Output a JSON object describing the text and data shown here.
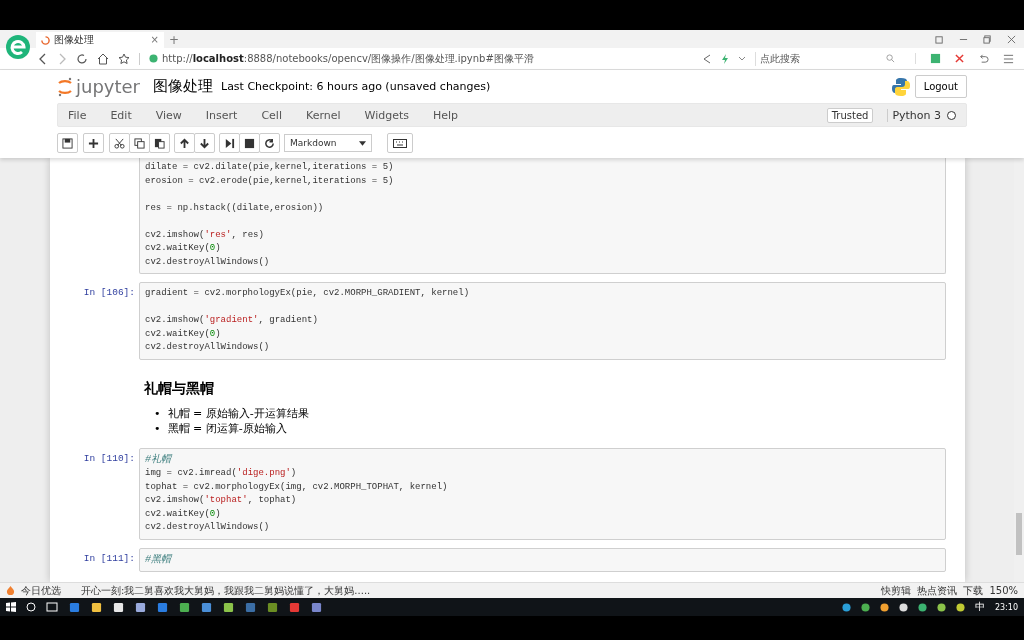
{
  "browser": {
    "tab_title": "图像处理",
    "tab_close": "×",
    "new_tab": "+",
    "url_prefix": "http://",
    "url_host": "localhost",
    "url_rest": ":8888/notebooks/opencv/图像操作/图像处理.ipynb#图像平滑",
    "search_placeholder": "点此搜索"
  },
  "notebook": {
    "logo_text": "jupyter",
    "title": "图像处理",
    "checkpoint": "Last Checkpoint: 6 hours ago (unsaved changes)",
    "logout": "Logout",
    "menu": [
      "File",
      "Edit",
      "View",
      "Insert",
      "Cell",
      "Kernel",
      "Widgets",
      "Help"
    ],
    "trusted": "Trusted",
    "kernel_name": "Python 3",
    "kernel_busy": false,
    "cell_type": "Markdown"
  },
  "cells": [
    {
      "kind": "code",
      "lines": [
        {
          "kind": "code",
          "segments": [
            {
              "kind": "plain",
              "text": "dilate = cv2.dilate(pie,kernel,iterations = 5)"
            }
          ]
        },
        {
          "kind": "code",
          "segments": [
            {
              "kind": "plain",
              "text": "erosion = cv2.erode(pie,kernel,iterations = 5)"
            }
          ]
        },
        {
          "kind": "blank"
        },
        {
          "kind": "code",
          "segments": [
            {
              "kind": "plain",
              "text": "res = np.hstack((dilate,erosion))"
            }
          ]
        },
        {
          "kind": "blank"
        },
        {
          "kind": "code",
          "segments": [
            {
              "kind": "plain",
              "text": "cv2.imshow("
            },
            {
              "kind": "string",
              "text": "'res'"
            },
            {
              "kind": "plain",
              "text": ", res)"
            }
          ]
        },
        {
          "kind": "code",
          "segments": [
            {
              "kind": "plain",
              "text": "cv2.waitKey("
            },
            {
              "kind": "number",
              "text": "0"
            },
            {
              "kind": "plain",
              "text": ")"
            }
          ]
        },
        {
          "kind": "code",
          "segments": [
            {
              "kind": "plain",
              "text": "cv2.destroyAllWindows()"
            }
          ]
        }
      ]
    },
    {
      "kind": "code",
      "prompt": "In [106]:",
      "lines": [
        {
          "kind": "code",
          "segments": [
            {
              "kind": "plain",
              "text": "gradient = cv2.morphologyEx(pie, cv2.MORPH_GRADIENT, kernel)"
            }
          ]
        },
        {
          "kind": "blank"
        },
        {
          "kind": "code",
          "segments": [
            {
              "kind": "plain",
              "text": "cv2.imshow("
            },
            {
              "kind": "string",
              "text": "'gradient'"
            },
            {
              "kind": "plain",
              "text": ", gradient)"
            }
          ]
        },
        {
          "kind": "code",
          "segments": [
            {
              "kind": "plain",
              "text": "cv2.waitKey("
            },
            {
              "kind": "number",
              "text": "0"
            },
            {
              "kind": "plain",
              "text": ")"
            }
          ]
        },
        {
          "kind": "code",
          "segments": [
            {
              "kind": "plain",
              "text": "cv2.destroyAllWindows()"
            }
          ]
        }
      ]
    },
    {
      "kind": "markdown",
      "heading": "礼帽与黑帽",
      "bullets": [
        {
          "marker": "•",
          "text": "礼帽 = 原始输入-开运算结果"
        },
        {
          "marker": "•",
          "text": "黑帽 = 闭运算-原始输入"
        }
      ]
    },
    {
      "kind": "code",
      "prompt": "In [110]:",
      "lines": [
        {
          "kind": "code",
          "segments": [
            {
              "kind": "comment",
              "text": "#礼帽"
            }
          ]
        },
        {
          "kind": "code",
          "segments": [
            {
              "kind": "plain",
              "text": "img = cv2.imread("
            },
            {
              "kind": "string",
              "text": "'dige.png'"
            },
            {
              "kind": "plain",
              "text": ")"
            }
          ]
        },
        {
          "kind": "code",
          "segments": [
            {
              "kind": "plain",
              "text": "tophat = cv2.morphologyEx(img, cv2.MORPH_TOPHAT, kernel)"
            }
          ]
        },
        {
          "kind": "code",
          "segments": [
            {
              "kind": "plain",
              "text": "cv2.imshow("
            },
            {
              "kind": "string",
              "text": "'tophat'"
            },
            {
              "kind": "plain",
              "text": ", tophat)"
            }
          ]
        },
        {
          "kind": "code",
          "segments": [
            {
              "kind": "plain",
              "text": "cv2.waitKey("
            },
            {
              "kind": "number",
              "text": "0"
            },
            {
              "kind": "plain",
              "text": ")"
            }
          ]
        },
        {
          "kind": "code",
          "segments": [
            {
              "kind": "plain",
              "text": "cv2.destroyAllWindows()"
            }
          ]
        }
      ]
    },
    {
      "kind": "code",
      "prompt": "In [111]:",
      "lines": [
        {
          "kind": "code",
          "segments": [
            {
              "kind": "comment",
              "text": "#黑帽"
            }
          ]
        }
      ]
    }
  ],
  "status_bar": {
    "left_label": "今日优选",
    "news": "开心一刻:我二舅喜欢我大舅妈，我跟我二舅妈说懂了，大舅妈.....",
    "items": [
      "快剪辑",
      "热点资讯",
      "下载"
    ],
    "zoom": "150%"
  },
  "taskbar": {
    "ime": "中",
    "time": "23:10"
  }
}
